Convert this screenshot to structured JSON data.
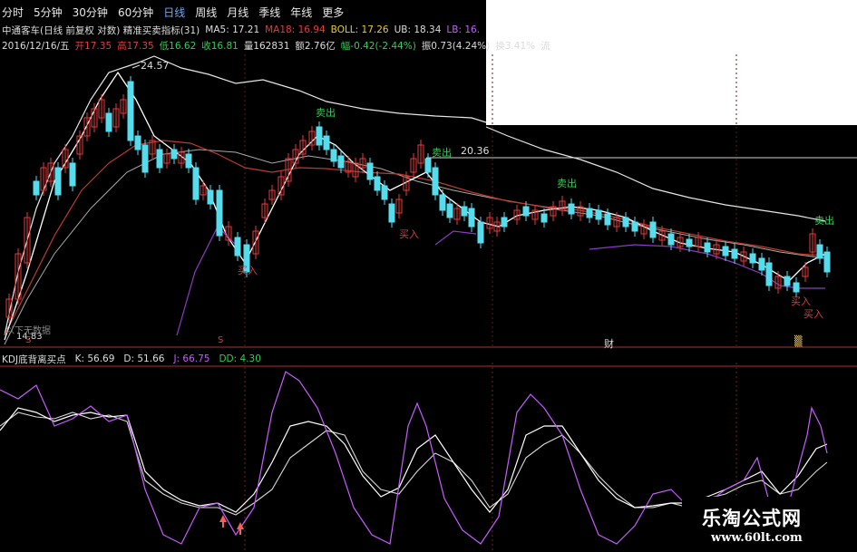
{
  "tabs": [
    "分时",
    "5分钟",
    "30分钟",
    "60分钟",
    "日线",
    "周线",
    "月线",
    "季线",
    "年线",
    "更多"
  ],
  "active_tab": "日线",
  "info_row1": {
    "title": "中通客车(日线 前复权 对数) 精准买卖指标(31)",
    "ma5": "MA5: 17.21",
    "ma18": "MA18: 16.94",
    "boll": "BOLL: 17.26",
    "ub": "UB: 18.34",
    "lb": "LB: 16."
  },
  "info_row2": {
    "date": "2016/12/16/五",
    "open": "开17.35",
    "high": "高17.35",
    "low": "低16.62",
    "close": "收16.81",
    "volume": "量162831",
    "amount": "额2.76亿",
    "change": "幅-0.42(-2.44%)",
    "amplitude": "振0.73(4.24%)",
    "turnover": "换3.41%",
    "flow": "流"
  },
  "chart_labels": {
    "high_price": "24.57",
    "level_price": "20.36",
    "low_price": "14.83",
    "no_data_note": "以下无数据",
    "sell": "卖出",
    "buy": "买入",
    "cai_marker": "财",
    "marker_2": "▒",
    "marker_s": "S"
  },
  "kdj_bar": {
    "name": "KDJ底背离买点",
    "k": "K: 56.69",
    "d": "D: 51.66",
    "j": "J: 66.75",
    "dd": "DD: 4.30"
  },
  "watermark": {
    "site_name": "乐淘公式网",
    "url": "www.60lt.com"
  },
  "colors": {
    "background": "#000000",
    "up": "#e33b3b",
    "down": "#55ddee",
    "sell_label": "#33cc55",
    "buy_label": "#e33b3b",
    "j_line": "#c75cff",
    "active_tab": "#6aa9ff"
  }
}
